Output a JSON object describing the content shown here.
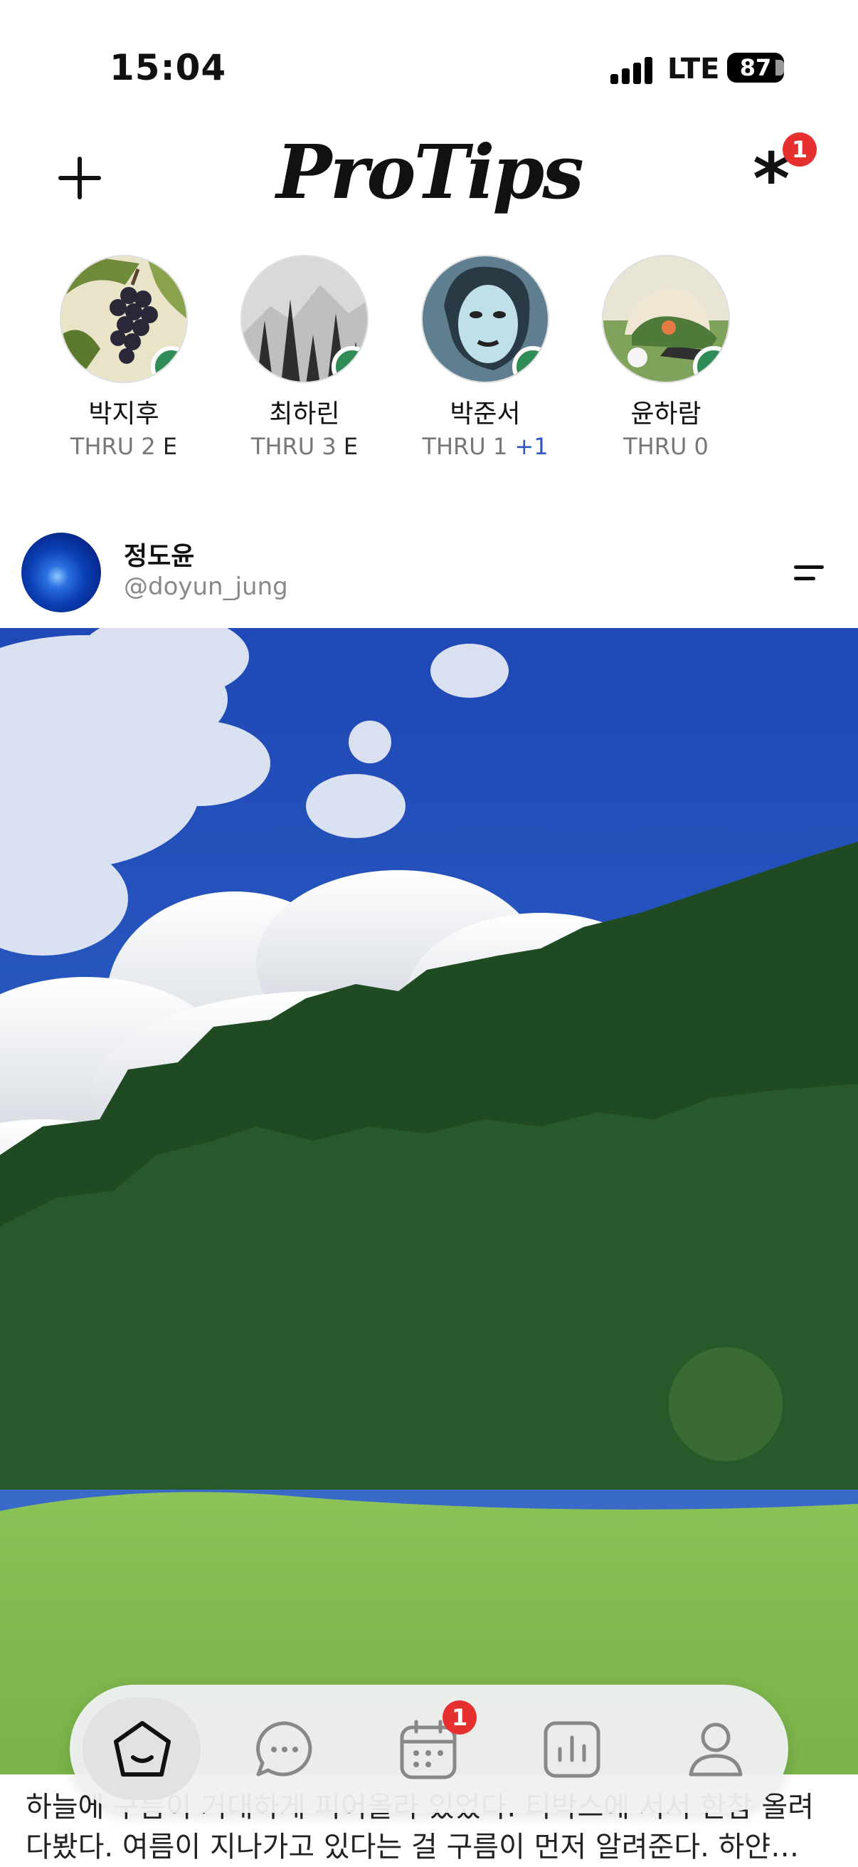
{
  "status_bar": {
    "time": "15:04",
    "network": "LTE",
    "battery": "87"
  },
  "header": {
    "logo": "ProTips",
    "notifications_badge": "1"
  },
  "stories": [
    {
      "name": "박지후",
      "thru": "THRU 2",
      "extra": "E"
    },
    {
      "name": "최하린",
      "thru": "THRU 3",
      "extra": "E"
    },
    {
      "name": "박준서",
      "thru": "THRU 1",
      "extra": "+1"
    },
    {
      "name": "윤하람",
      "thru": "THRU 0",
      "extra": ""
    }
  ],
  "post": {
    "author_name": "정도윤",
    "author_handle": "@doyun_jung",
    "caption_line1": "하늘에 구름이 거대하게 피어올라 있었다. 티박스에 서서 한참 올려",
    "caption_line2": "다봤다. 여름이 지나가고 있다는 걸 구름이 먼저 알려준다. 하얀…"
  },
  "tabbar": {
    "calendar_badge": "1"
  }
}
